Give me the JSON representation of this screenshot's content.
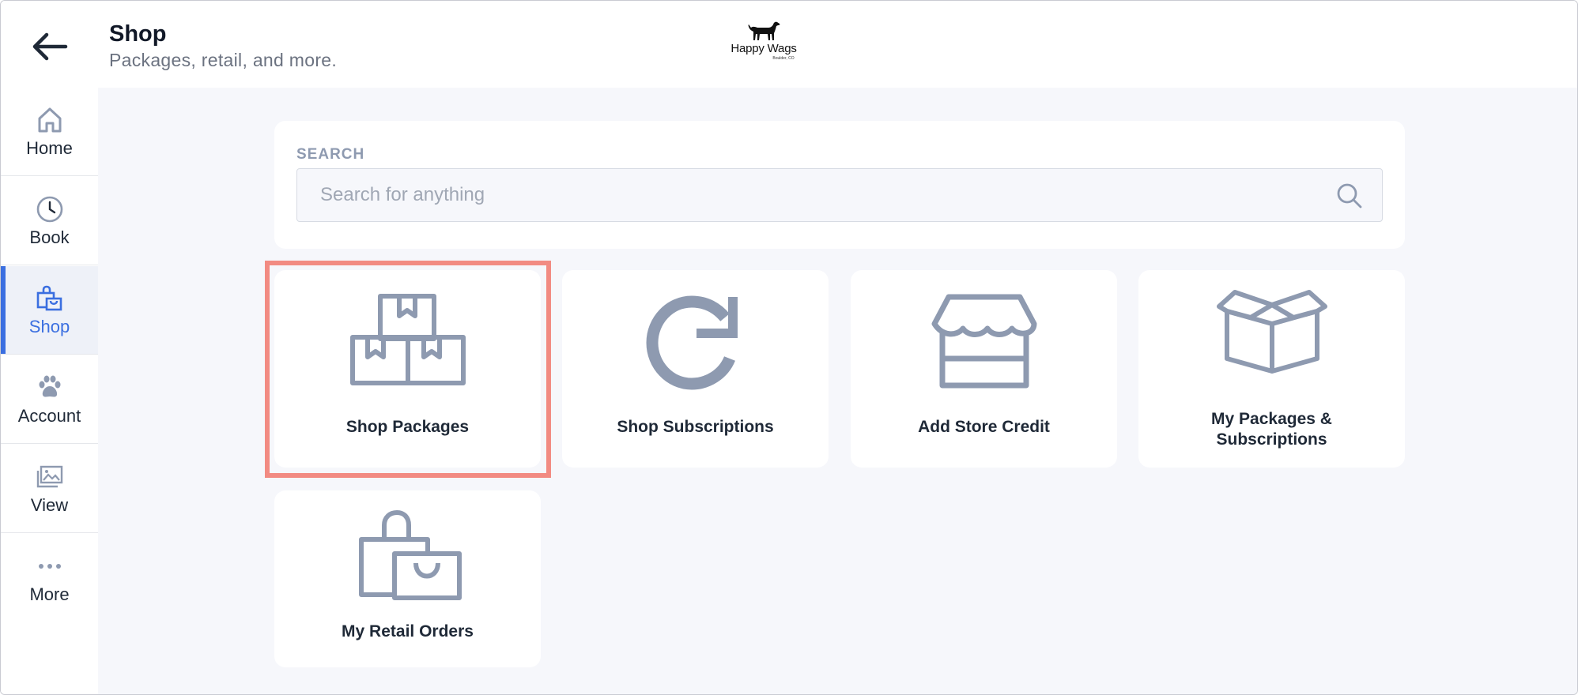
{
  "header": {
    "title": "Shop",
    "subtitle": "Packages, retail, and more.",
    "logo": {
      "name": "Happy Wags",
      "location": "Boulder, CO"
    }
  },
  "sidebar": {
    "items": [
      {
        "label": "Home",
        "icon": "home-icon"
      },
      {
        "label": "Book",
        "icon": "clock-icon"
      },
      {
        "label": "Shop",
        "icon": "shopping-bag-icon",
        "active": true
      },
      {
        "label": "Account",
        "icon": "paw-icon"
      },
      {
        "label": "View",
        "icon": "images-icon"
      },
      {
        "label": "More",
        "icon": "more-dots-icon"
      }
    ]
  },
  "search": {
    "label": "SEARCH",
    "placeholder": "Search for anything",
    "value": ""
  },
  "tiles": [
    {
      "label": "Shop Packages",
      "icon": "boxes-icon",
      "highlighted": true
    },
    {
      "label": "Shop Subscriptions",
      "icon": "refresh-icon"
    },
    {
      "label": "Add Store Credit",
      "icon": "storefront-icon"
    },
    {
      "label": "My Packages &",
      "label2": "Subscriptions",
      "icon": "open-box-icon"
    },
    {
      "label": "My Retail Orders",
      "icon": "bags-icon"
    }
  ],
  "colors": {
    "accent": "#3b6fe0",
    "icon": "#8e9ab0",
    "highlight": "#f28b82",
    "background": "#f6f7fb"
  }
}
